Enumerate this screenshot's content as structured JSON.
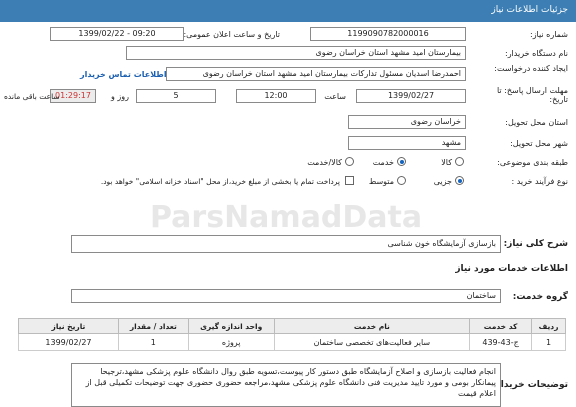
{
  "header": {
    "title": "جزئیات اطلاعات نیاز"
  },
  "fields": {
    "need_number_label": "شماره نیاز:",
    "need_number": "1199090782000016",
    "announce_label": "تاریخ و ساعت اعلان عمومی:",
    "announce_value": "1399/02/22 - 09:20",
    "buyer_org_label": "نام دستگاه خریدار:",
    "buyer_org": "بیمارستان امید مشهد استان خراسان رضوی",
    "creator_label": "ایجاد کننده درخواست:",
    "creator": "احمدرضا اسدیان مسئول تدارکات بیمارستان امید مشهد استان خراسان رضوی",
    "contact_link": "اطلاعات تماس خریدار",
    "deadline_label": "مهلت ارسال پاسخ: تا تاریخ:",
    "deadline_date": "1399/02/27",
    "time_label": "ساعت",
    "deadline_time": "12:00",
    "days_value": "5",
    "days_label": "روز و",
    "remaining_time": "01:29:17",
    "remaining_label": "ساعت باقی مانده",
    "province_label": "استان محل تحویل:",
    "province": "خراسان رضوی",
    "city_label": "شهر محل تحویل:",
    "city": "مشهد",
    "category_label": "طبقه بندی موضوعی:",
    "category_options": [
      "کالا",
      "خدمت",
      "کالا/خدمت"
    ],
    "process_label": "نوع فرآیند خرید :",
    "process_options": [
      "جزیی",
      "متوسط"
    ],
    "payment_note": "پرداخت تمام یا بخشی از مبلغ خرید،از محل \"اسناد خزانه اسلامی\" خواهد بود.",
    "summary_label": "شرح کلی نیاز:",
    "summary": "بازسازی آزمایشگاه خون شناسی"
  },
  "services": {
    "title": "اطلاعات خدمات مورد نیاز",
    "group_label": "گروه خدمت:",
    "group_value": "ساختمان",
    "columns": [
      "ردیف",
      "کد خدمت",
      "نام خدمت",
      "واحد اندازه گیری",
      "تعداد / مقدار",
      "تاریخ نیاز"
    ],
    "rows": [
      [
        "1",
        "ج-43-439",
        "سایر فعالیت‌های تخصصی ساختمان",
        "پروژه",
        "1",
        "1399/02/27"
      ]
    ]
  },
  "buyer_notes": {
    "label": "توضیحات خریدار:",
    "text": "انجام فعالیت  بازسازی و اصلاح آزمایشگاه طبق دستور کار پیوست،تسویه طبق روال دانشگاه علوم پزشکی مشهد،ترجیحا پیمانکار بومی و مورد تایید مدیریت فنی دانشگاه علوم پزشکی مشهد،مراجعه حضوری حضوری جهت توضیحات تکمیلی قبل از اعلام قیمت"
  },
  "colors": {
    "header": "#3d7fb4",
    "link": "#1b5fb0",
    "radio_on": "#1565c0"
  }
}
